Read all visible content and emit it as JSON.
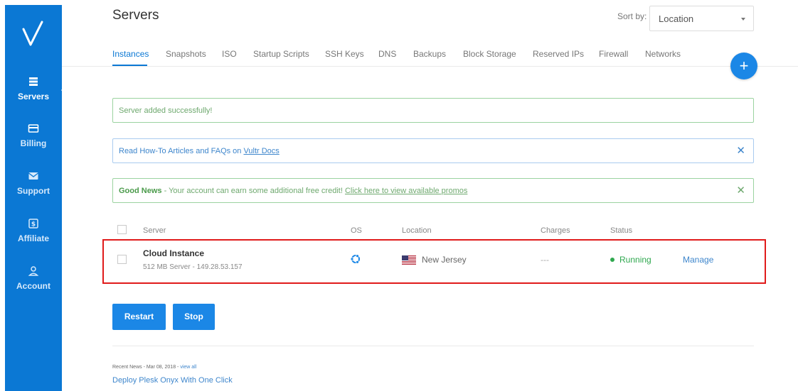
{
  "app": {
    "logo_letter": "V"
  },
  "sidebar": {
    "items": [
      {
        "label": "Servers",
        "icon": "servers-icon",
        "active": true
      },
      {
        "label": "Billing",
        "icon": "billing-card-icon",
        "active": false
      },
      {
        "label": "Support",
        "icon": "envelope-icon",
        "active": false
      },
      {
        "label": "Affiliate",
        "icon": "dollar-icon",
        "active": false
      },
      {
        "label": "Account",
        "icon": "user-icon",
        "active": false
      }
    ]
  },
  "header": {
    "title": "Servers",
    "sort_label": "Sort by:",
    "sort_value": "Location"
  },
  "tabs": [
    "Instances",
    "Snapshots",
    "ISO",
    "Startup Scripts",
    "SSH Keys",
    "DNS",
    "Backups",
    "Block Storage",
    "Reserved IPs",
    "Firewall",
    "Networks"
  ],
  "fab_label": "+",
  "alerts": {
    "success": {
      "text": "Server added successfully!"
    },
    "info": {
      "prefix": "Read How-To Articles and FAQs on ",
      "link": "Vultr Docs",
      "close": "✕"
    },
    "promo": {
      "bold": "Good News",
      "text": " - Your account can earn some additional free credit! ",
      "link": "Click here to view available promos",
      "close": "✕"
    }
  },
  "table": {
    "headers": {
      "server": "Server",
      "os": "OS",
      "location": "Location",
      "charges": "Charges",
      "status": "Status"
    },
    "rows": [
      {
        "name": "Cloud Instance",
        "subtitle": "512 MB Server - 149.28.53.157",
        "os_icon": "ubuntu-icon",
        "flag": "us-flag-icon",
        "location": "New Jersey",
        "charges": "---",
        "status": "Running",
        "action": "Manage"
      }
    ]
  },
  "buttons": {
    "restart": "Restart",
    "stop": "Stop"
  },
  "news": {
    "meta_prefix": "Recent News - Mar 08, 2018 - ",
    "meta_link": "view all",
    "title": "Deploy Plesk Onyx With One Click"
  },
  "colors": {
    "primary": "#0b78d4",
    "button": "#1b87e6",
    "success": "#2fa84f",
    "highlight": "#e01b1b"
  }
}
